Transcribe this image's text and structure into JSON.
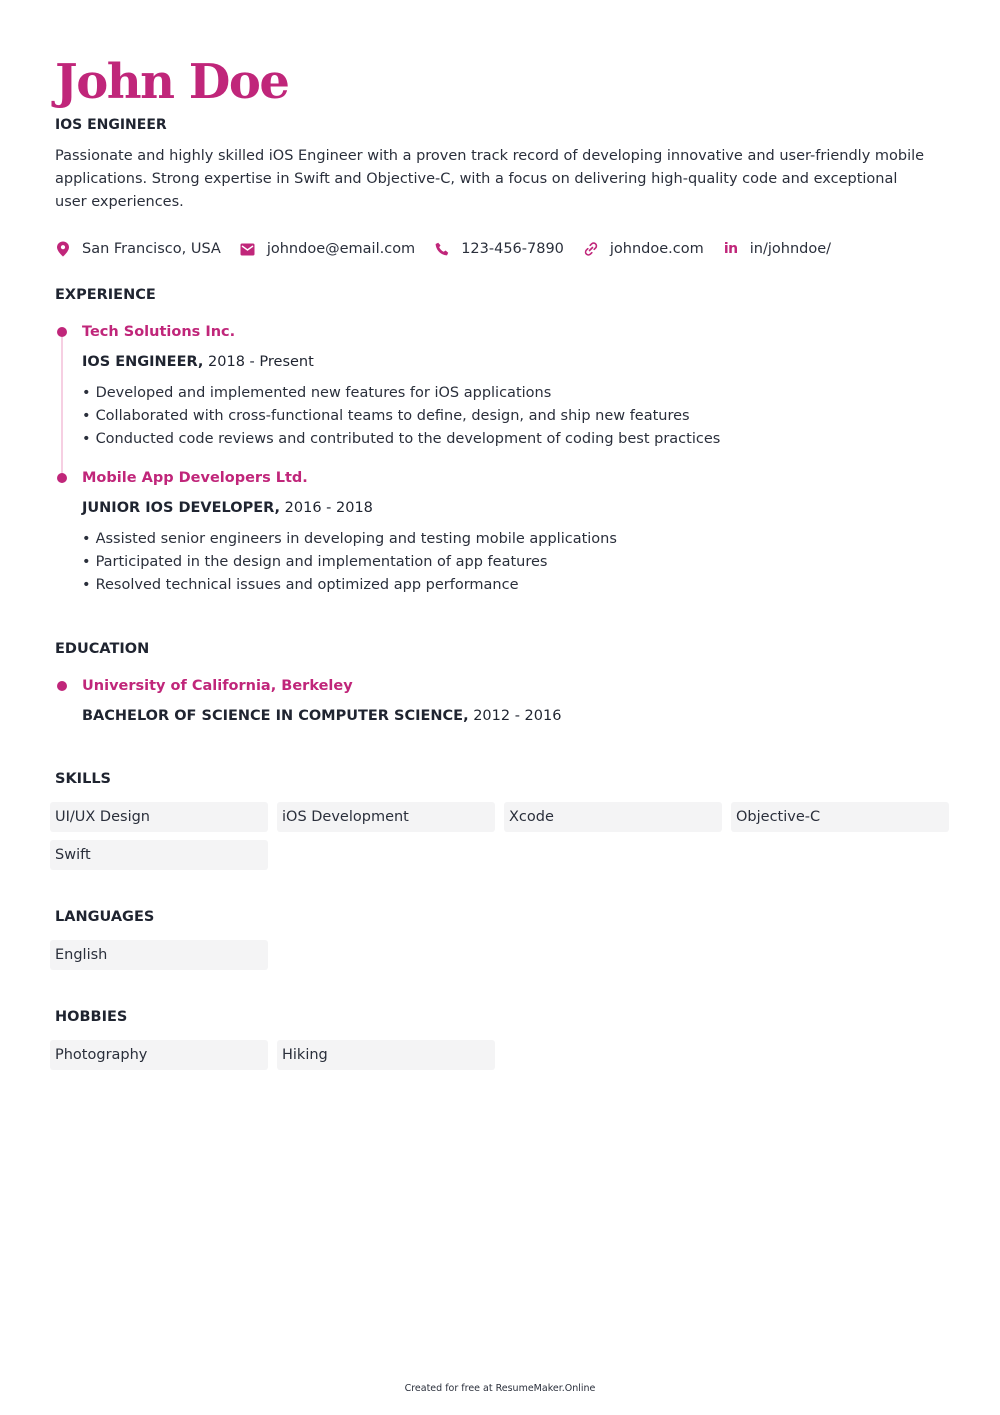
{
  "header": {
    "name": "John Doe",
    "job_title": "IOS ENGINEER",
    "summary": "Passionate and highly skilled iOS Engineer with a proven track record of developing innovative and user-friendly mobile applications. Strong expertise in Swift and Objective-C, with a focus on delivering high-quality code and exceptional user experiences."
  },
  "contacts": [
    {
      "icon": "location-pin-icon",
      "text": "San Francisco, USA"
    },
    {
      "icon": "email-icon",
      "text": "johndoe@email.com"
    },
    {
      "icon": "phone-icon",
      "text": "123-456-7890"
    },
    {
      "icon": "link-icon",
      "text": "johndoe.com"
    },
    {
      "icon": "linkedin-icon",
      "text": "in/johndoe/",
      "glyph": "in"
    }
  ],
  "experience": {
    "title": "EXPERIENCE",
    "items": [
      {
        "company": "Tech Solutions Inc.",
        "role": "IOS ENGINEER,",
        "dates": "2018 - Present",
        "bullets": [
          "Developed and implemented new features for iOS applications",
          "Collaborated with cross-functional teams to define, design, and ship new features",
          "Conducted code reviews and contributed to the development of coding best practices"
        ]
      },
      {
        "company": "Mobile App Developers Ltd.",
        "role": "JUNIOR IOS DEVELOPER,",
        "dates": "2016 - 2018",
        "bullets": [
          "Assisted senior engineers in developing and testing mobile applications",
          "Participated in the design and implementation of app features",
          "Resolved technical issues and optimized app performance"
        ]
      }
    ]
  },
  "education": {
    "title": "EDUCATION",
    "items": [
      {
        "school": "University of California, Berkeley",
        "degree": "BACHELOR OF SCIENCE IN COMPUTER SCIENCE,",
        "dates": "2012 - 2016"
      }
    ]
  },
  "skills": {
    "title": "SKILLS",
    "items": [
      "UI/UX Design",
      "iOS Development",
      "Xcode",
      "Objective-C",
      "Swift"
    ]
  },
  "languages": {
    "title": "LANGUAGES",
    "items": [
      "English"
    ]
  },
  "hobbies": {
    "title": "HOBBIES",
    "items": [
      "Photography",
      "Hiking"
    ]
  },
  "footer": "Created for free at ResumeMaker.Online",
  "colors": {
    "accent": "#c0267a",
    "text": "#1f2430",
    "chip_bg": "#f4f4f5",
    "timeline": "#f6cfe2"
  }
}
